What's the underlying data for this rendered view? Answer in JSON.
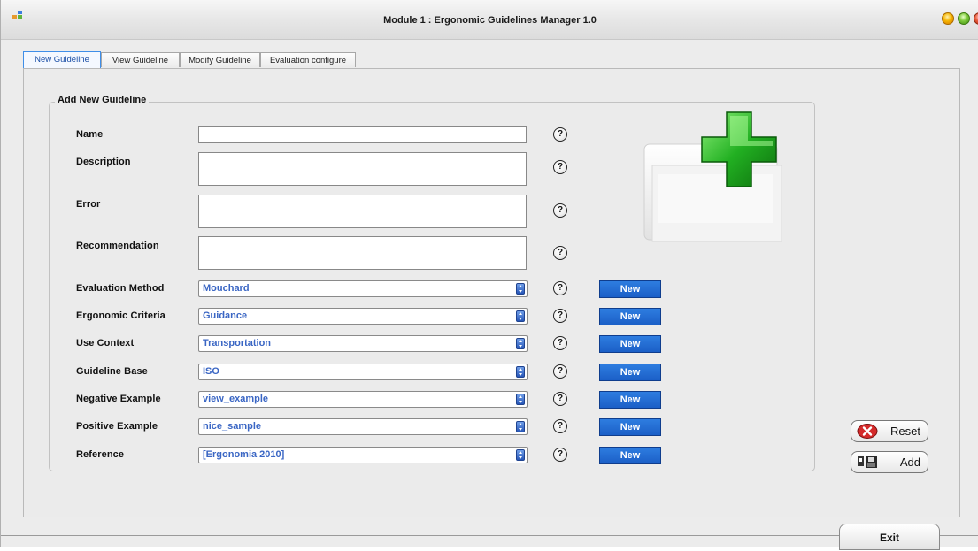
{
  "window": {
    "title": "Module 1 : Ergonomic Guidelines Manager 1.0"
  },
  "tabs": [
    {
      "label": "New Guideline",
      "active": true
    },
    {
      "label": "View Guideline",
      "active": false
    },
    {
      "label": "Modify Guideline",
      "active": false
    },
    {
      "label": "Evaluation configure",
      "active": false
    }
  ],
  "form": {
    "group_title": "Add New Guideline",
    "help_symbol": "?",
    "new_label": "New",
    "text_fields": [
      {
        "label": "Name",
        "value": ""
      },
      {
        "label": "Description",
        "value": ""
      },
      {
        "label": "Error",
        "value": ""
      },
      {
        "label": "Recommendation",
        "value": ""
      }
    ],
    "combos": [
      {
        "label": "Evaluation Method",
        "value": "Mouchard"
      },
      {
        "label": "Ergonomic Criteria",
        "value": "Guidance"
      },
      {
        "label": "Use Context",
        "value": "Transportation"
      },
      {
        "label": "Guideline Base",
        "value": "ISO"
      },
      {
        "label": "Negative Example",
        "value": "view_example"
      },
      {
        "label": "Positive Example",
        "value": "nice_sample"
      },
      {
        "label": "Reference",
        "value": "[Ergonomia 2010]"
      }
    ]
  },
  "buttons": {
    "reset": "Reset",
    "add": "Add",
    "exit": "Exit"
  },
  "icons": {
    "app": "app-icon",
    "help": "help-icon",
    "reset": "cancel-x-icon",
    "add": "save-icon",
    "illustration": "add-document-icon"
  },
  "colors": {
    "new_button": "#2e7de0",
    "combo_text": "#3a66c4",
    "plus_green": "#22b022"
  }
}
